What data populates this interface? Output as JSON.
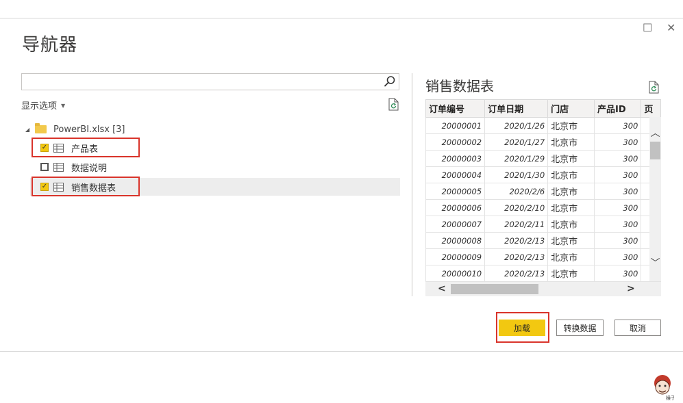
{
  "window": {
    "title": "导航器",
    "maximize_glyph": "☐",
    "close_glyph": "✕"
  },
  "left": {
    "search_value": "",
    "display_options_label": "显示选项",
    "tree": {
      "root_label": "PowerBI.xlsx [3]",
      "items": [
        {
          "label": "产品表",
          "checked": true
        },
        {
          "label": "数据说明",
          "checked": false
        },
        {
          "label": "销售数据表",
          "checked": true
        }
      ]
    }
  },
  "preview": {
    "title": "销售数据表",
    "columns": [
      "订单编号",
      "订单日期",
      "门店",
      "产品ID",
      "页"
    ],
    "rows": [
      [
        "20000001",
        "2020/1/26",
        "北京市",
        "300"
      ],
      [
        "20000002",
        "2020/1/27",
        "北京市",
        "300"
      ],
      [
        "20000003",
        "2020/1/29",
        "北京市",
        "300"
      ],
      [
        "20000004",
        "2020/1/30",
        "北京市",
        "300"
      ],
      [
        "20000005",
        "2020/2/6",
        "北京市",
        "300"
      ],
      [
        "20000006",
        "2020/2/10",
        "北京市",
        "300"
      ],
      [
        "20000007",
        "2020/2/11",
        "北京市",
        "300"
      ],
      [
        "20000008",
        "2020/2/13",
        "北京市",
        "300"
      ],
      [
        "20000009",
        "2020/2/13",
        "北京市",
        "300"
      ],
      [
        "20000010",
        "2020/2/13",
        "北京市",
        "300"
      ]
    ]
  },
  "buttons": {
    "load": "加载",
    "transform": "转换数据",
    "cancel": "取消"
  },
  "colors": {
    "accent": "#f2c811",
    "highlight": "#d9342b"
  },
  "watermark": {
    "text": "猴子"
  }
}
